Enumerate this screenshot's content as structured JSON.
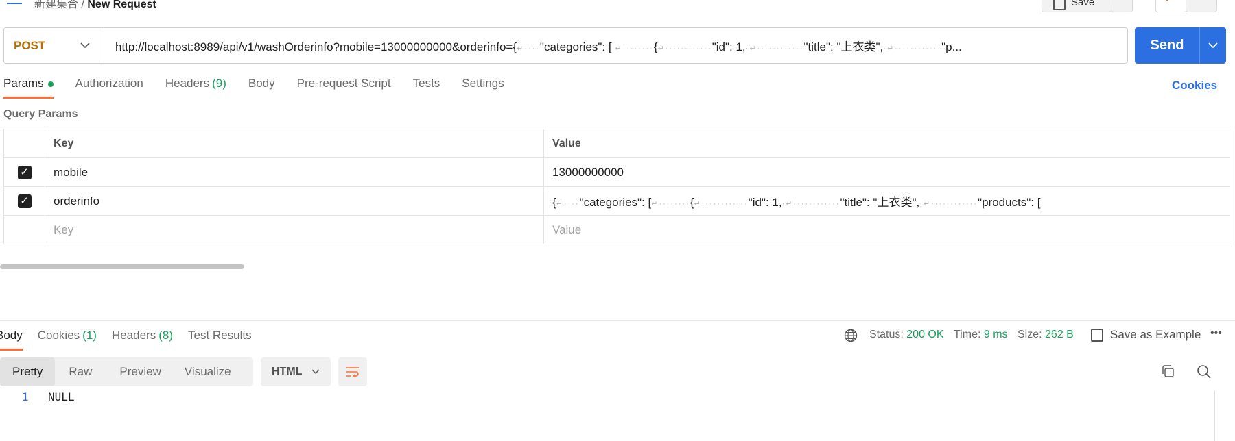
{
  "header": {
    "breadcrumb_parent": "新建集合",
    "request_name": "New Request",
    "save_label": "Save"
  },
  "url_bar": {
    "method": "POST",
    "url": "http://localhost:8989/api/v1/washOrderinfo?mobile=13000000000&orderinfo={",
    "url_tail_1": "\"categories\": [",
    "url_tail_2": "{",
    "url_tail_3": "\"id\": 1,",
    "url_tail_4": "\"title\": \"上衣类\",",
    "url_tail_5": "\"p..."
  },
  "send_label": "Send",
  "tabs": [
    {
      "label": "Params"
    },
    {
      "label": "Authorization"
    },
    {
      "label": "Headers",
      "count": "(9)"
    },
    {
      "label": "Body"
    },
    {
      "label": "Pre-request Script"
    },
    {
      "label": "Tests"
    },
    {
      "label": "Settings"
    }
  ],
  "cookies_link": "Cookies",
  "query_params": {
    "title": "Query Params",
    "headers": {
      "key": "Key",
      "value": "Value"
    },
    "rows": [
      {
        "key": "mobile",
        "value": "13000000000"
      },
      {
        "key": "orderinfo",
        "value_1": "{",
        "value_2": "\"categories\": [",
        "value_3": "{",
        "value_4": "\"id\": 1,",
        "value_5": "\"title\": \"上衣类\",",
        "value_6": "\"products\": ["
      }
    ],
    "placeholder": {
      "key": "Key",
      "value": "Value"
    }
  },
  "response": {
    "tabs": [
      {
        "label": "Body"
      },
      {
        "label": "Cookies",
        "count": "(1)"
      },
      {
        "label": "Headers",
        "count": "(8)"
      },
      {
        "label": "Test Results"
      }
    ],
    "status_label": "Status:",
    "status_value": "200 OK",
    "time_label": "Time:",
    "time_value": "9 ms",
    "size_label": "Size:",
    "size_value": "262 B",
    "save_example": "Save as Example",
    "more": "•••",
    "views": [
      "Pretty",
      "Raw",
      "Preview",
      "Visualize"
    ],
    "format": "HTML",
    "line_number": "1",
    "body_text": "NULL"
  },
  "colors": {
    "accent": "#ff6c37",
    "send": "#2b6fe0",
    "success": "#1aa05e",
    "method": "#b86e00"
  }
}
